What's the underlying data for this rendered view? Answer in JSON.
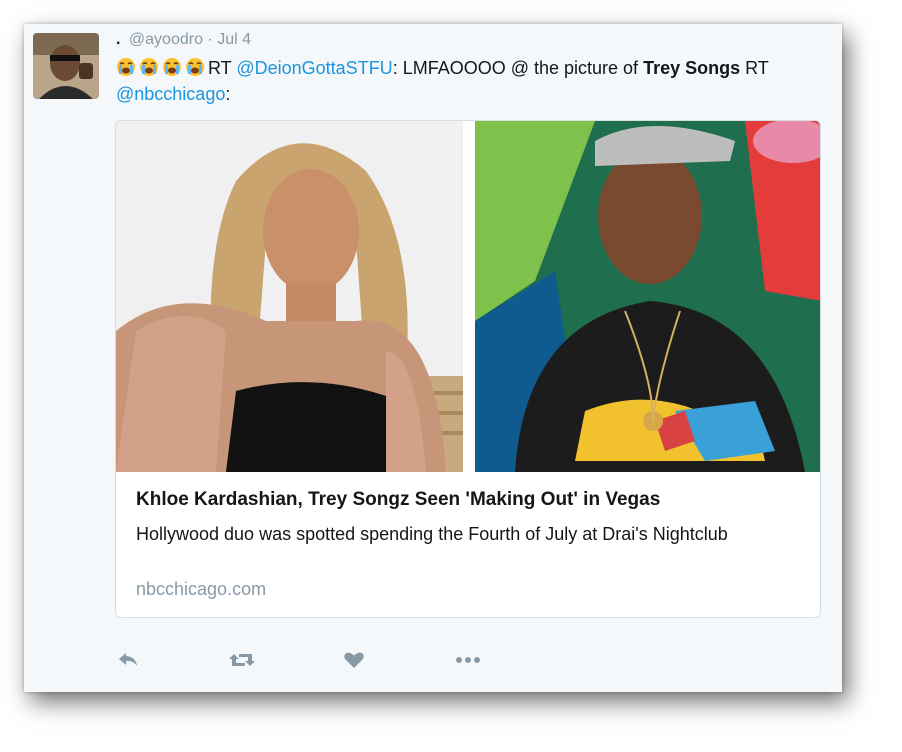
{
  "tweet": {
    "display_name": ".",
    "handle": "@ayoodro",
    "separator": "·",
    "date": "Jul 4",
    "body": {
      "rt1": "RT",
      "mention1": "@DeionGottaSTFU",
      "text1": ": LMFAOOOO @ the picture of",
      "bold_name": "Trey Songs",
      "rt2": "RT",
      "mention2": "@nbcchicago",
      "colon": ":"
    },
    "emoji": [
      "loudly-crying-face",
      "loudly-crying-face",
      "loudly-crying-face",
      "loudly-crying-face"
    ]
  },
  "card": {
    "title": "Khloe Kardashian, Trey Songz Seen 'Making Out' in Vegas",
    "description": "Hollywood duo was spotted spending the Fourth of July at Drai's Nightclub",
    "domain": "nbcchicago.com"
  },
  "actions": [
    "reply-icon",
    "retweet-icon",
    "like-icon",
    "more-icon"
  ],
  "colors": {
    "link": "#1b95e0",
    "muted": "#8899a6",
    "text": "#14171a",
    "background": "#f5f8fa",
    "emoji": "#fdc02f"
  }
}
